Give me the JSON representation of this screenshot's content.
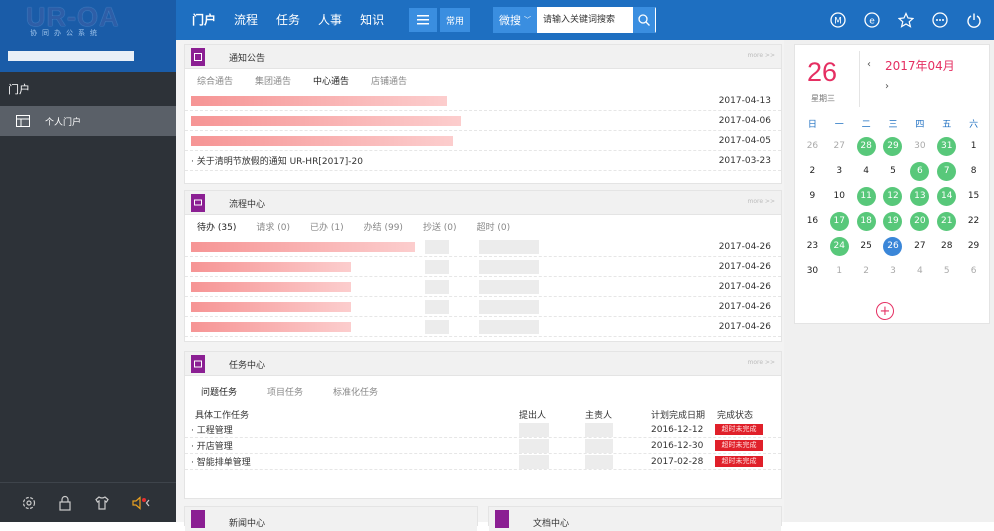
{
  "app": {
    "logo_text": "UR-OA",
    "logo_sub": "协同办公系统"
  },
  "nav": {
    "items": [
      {
        "label": "门户"
      },
      {
        "label": "流程"
      },
      {
        "label": "任务"
      },
      {
        "label": "人事"
      },
      {
        "label": "知识"
      }
    ],
    "common_label": "常用",
    "search_scope": "微搜",
    "search_placeholder": "请输入关键词搜索"
  },
  "sidebar": {
    "section_title": "门户",
    "items": [
      {
        "label": "个人门户"
      }
    ]
  },
  "panels": {
    "notice": {
      "title": "通知公告",
      "more": "more >>",
      "tabs": [
        "综合通告",
        "集团通告",
        "中心通告",
        "店铺通告"
      ],
      "rows": [
        {
          "text": "",
          "date": "2017-04-13"
        },
        {
          "text": "",
          "date": "2017-04-06"
        },
        {
          "text": "",
          "date": "2017-04-05"
        },
        {
          "text": "· 关于清明节放假的通知 UR-HR[2017]-20",
          "date": "2017-03-23"
        }
      ]
    },
    "workflow": {
      "title": "流程中心",
      "more": "more >>",
      "tabs": [
        "待办 (35)",
        "请求 (0)",
        "已办 (1)",
        "办结 (99)",
        "抄送 (0)",
        "超时 (0)"
      ],
      "dates": [
        "2017-04-26",
        "2017-04-26",
        "2017-04-26",
        "2017-04-26",
        "2017-04-26"
      ]
    },
    "task": {
      "title": "任务中心",
      "more": "more >>",
      "tabs": [
        "问题任务",
        "项目任务",
        "标准化任务"
      ],
      "headers": {
        "name": "具体工作任务",
        "proposer": "提出人",
        "owner": "主责人",
        "due": "计划完成日期",
        "status": "完成状态"
      },
      "rows": [
        {
          "name": "· 工程管理",
          "due": "2016-12-12",
          "status": "超时未完成"
        },
        {
          "name": "· 开店管理",
          "due": "2016-12-30",
          "status": "超时未完成"
        },
        {
          "name": "· 智能排单管理",
          "due": "2017-02-28",
          "status": "超时未完成"
        }
      ]
    },
    "news": {
      "title": "新闻中心"
    },
    "docs": {
      "title": "文档中心"
    }
  },
  "calendar": {
    "day": "26",
    "weekday": "星期三",
    "month": "2017年04月",
    "weekdays": [
      "日",
      "一",
      "二",
      "三",
      "四",
      "五",
      "六"
    ],
    "cells": [
      {
        "d": "26",
        "t": "other"
      },
      {
        "d": "27",
        "t": "other"
      },
      {
        "d": "28",
        "t": "green"
      },
      {
        "d": "29",
        "t": "green"
      },
      {
        "d": "30",
        "t": "other"
      },
      {
        "d": "31",
        "t": "green"
      },
      {
        "d": "1",
        "t": ""
      },
      {
        "d": "2",
        "t": ""
      },
      {
        "d": "3",
        "t": ""
      },
      {
        "d": "4",
        "t": ""
      },
      {
        "d": "5",
        "t": ""
      },
      {
        "d": "6",
        "t": "green"
      },
      {
        "d": "7",
        "t": "green"
      },
      {
        "d": "8",
        "t": ""
      },
      {
        "d": "9",
        "t": ""
      },
      {
        "d": "10",
        "t": ""
      },
      {
        "d": "11",
        "t": "green"
      },
      {
        "d": "12",
        "t": "green"
      },
      {
        "d": "13",
        "t": "green"
      },
      {
        "d": "14",
        "t": "green"
      },
      {
        "d": "15",
        "t": ""
      },
      {
        "d": "16",
        "t": ""
      },
      {
        "d": "17",
        "t": "green"
      },
      {
        "d": "18",
        "t": "green"
      },
      {
        "d": "19",
        "t": "green"
      },
      {
        "d": "20",
        "t": "green"
      },
      {
        "d": "21",
        "t": "green"
      },
      {
        "d": "22",
        "t": ""
      },
      {
        "d": "23",
        "t": ""
      },
      {
        "d": "24",
        "t": "green"
      },
      {
        "d": "25",
        "t": ""
      },
      {
        "d": "26",
        "t": "today"
      },
      {
        "d": "27",
        "t": ""
      },
      {
        "d": "28",
        "t": ""
      },
      {
        "d": "29",
        "t": ""
      },
      {
        "d": "30",
        "t": ""
      },
      {
        "d": "1",
        "t": "other"
      },
      {
        "d": "2",
        "t": "other"
      },
      {
        "d": "3",
        "t": "other"
      },
      {
        "d": "4",
        "t": "other"
      },
      {
        "d": "5",
        "t": "other"
      },
      {
        "d": "6",
        "t": "other"
      }
    ]
  }
}
